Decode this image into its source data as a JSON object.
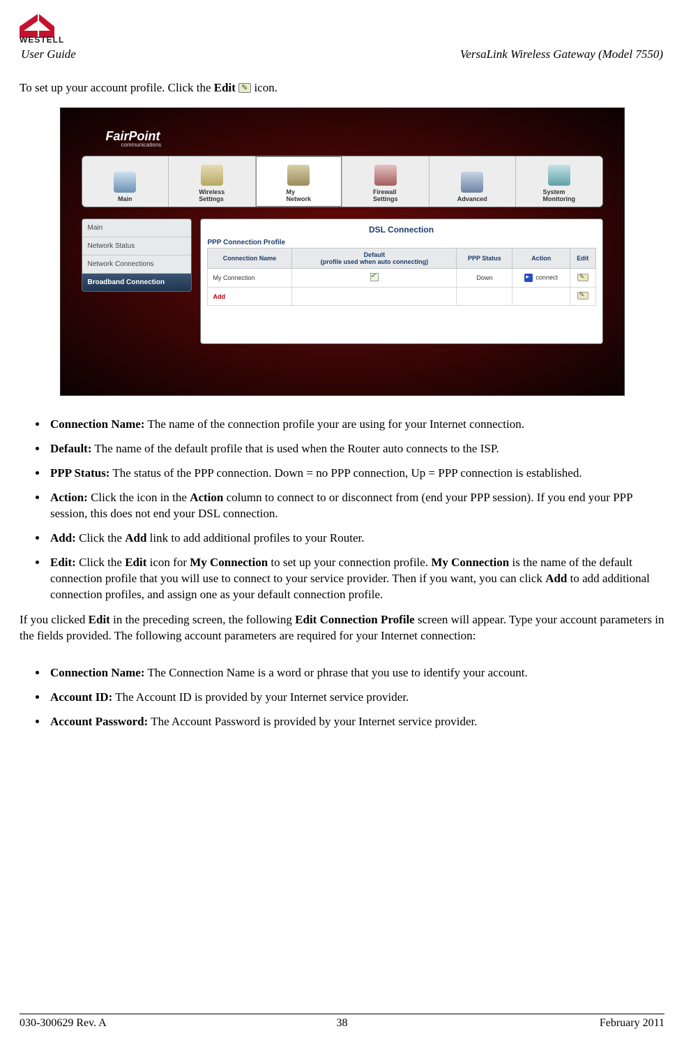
{
  "brand": "WESTELL",
  "header": {
    "left": "User Guide",
    "right": "VersaLink Wireless Gateway (Model 7550)"
  },
  "intro": {
    "prefix": "To set up your account profile. Click the ",
    "bold": "Edit",
    "suffix": " icon."
  },
  "screenshot": {
    "logo": "FairPoint",
    "logo_sub": "communications",
    "tabs": [
      "Main",
      "Wireless Settings",
      "My Network",
      "Firewall Settings",
      "Advanced",
      "System Monitoring"
    ],
    "active_tab_index": 2,
    "sidebar": [
      "Main",
      "Network Status",
      "Network Connections",
      "Broadband Connection"
    ],
    "sidebar_active_index": 3,
    "panel_title": "DSL Connection",
    "panel_subheader": "PPP Connection Profile",
    "table": {
      "headers": [
        "Connection Name",
        "Default (profile used when auto connecting)",
        "PPP Status",
        "Action",
        "Edit"
      ],
      "rows": [
        {
          "name": "My Connection",
          "default_checked": true,
          "status": "Down",
          "action": "connect",
          "has_edit": true
        },
        {
          "name": "Add",
          "is_add": true,
          "has_edit": true
        }
      ]
    }
  },
  "defs1": [
    {
      "label": "Connection Name:",
      "text": " The name of the connection profile your are using for your Internet connection."
    },
    {
      "label": "Default:",
      "text": " The name of the default profile that is used when the Router auto connects to the ISP."
    },
    {
      "label": "PPP Status:",
      "text": " The status of the PPP connection. Down = no PPP connection, Up = PPP connection is established."
    },
    {
      "label": "Action:",
      "runs": [
        " Click the icon in the ",
        {
          "b": "Action"
        },
        " column to connect to or disconnect from (end your PPP session). If you end your PPP session, this does not end your DSL connection."
      ]
    },
    {
      "label": "Add:",
      "runs": [
        " Click the ",
        {
          "b": "Add"
        },
        " link to add additional profiles to your Router."
      ]
    },
    {
      "label": "Edit:",
      "runs": [
        " Click the ",
        {
          "b": "Edit"
        },
        " icon for ",
        {
          "b": "My Connection"
        },
        " to set up your connection profile. ",
        {
          "b": "My Connection"
        },
        " is the name of the default connection profile that you will use to connect to your service provider. Then if you want, you can click ",
        {
          "b": "Add"
        },
        " to add additional connection profiles, and assign one as your default connection profile."
      ]
    }
  ],
  "mid_para": {
    "runs": [
      "If you clicked ",
      {
        "b": "Edit"
      },
      " in the preceding screen, the following ",
      {
        "b": "Edit Connection Profile"
      },
      " screen will appear. Type your account parameters in the fields provided. The following account parameters are required for your Internet connection:"
    ]
  },
  "defs2": [
    {
      "label": "Connection Name:",
      "text": " The Connection Name is a word or phrase that you use to identify your account."
    },
    {
      "label": "Account ID:",
      "text": " The Account ID is provided by your Internet service provider."
    },
    {
      "label": "Account Password:",
      "text": " The Account Password is provided by your Internet service provider."
    }
  ],
  "footer": {
    "left": "030-300629 Rev. A",
    "center": "38",
    "right": "February 2011"
  }
}
